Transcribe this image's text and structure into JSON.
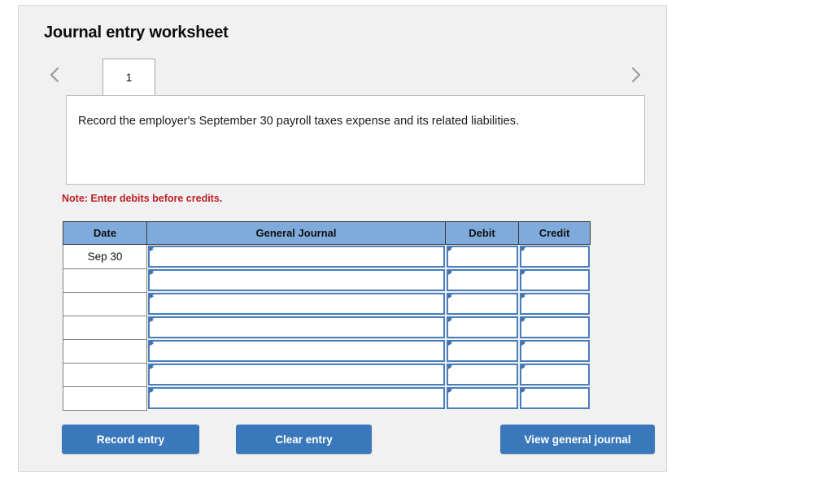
{
  "panel": {
    "title": "Journal entry worksheet"
  },
  "nav": {
    "prev_icon": "chevron-left-icon",
    "next_icon": "chevron-right-icon",
    "tabs": [
      {
        "label": "1",
        "active": true
      }
    ]
  },
  "instruction": {
    "text": "Record the employer's September 30 payroll taxes expense and its related liabilities."
  },
  "note": {
    "text": "Note: Enter debits before credits."
  },
  "table": {
    "headers": {
      "date": "Date",
      "general_journal": "General Journal",
      "debit": "Debit",
      "credit": "Credit"
    },
    "rows": [
      {
        "date": "Sep 30",
        "general_journal": "",
        "debit": "",
        "credit": ""
      },
      {
        "date": "",
        "general_journal": "",
        "debit": "",
        "credit": ""
      },
      {
        "date": "",
        "general_journal": "",
        "debit": "",
        "credit": ""
      },
      {
        "date": "",
        "general_journal": "",
        "debit": "",
        "credit": ""
      },
      {
        "date": "",
        "general_journal": "",
        "debit": "",
        "credit": ""
      },
      {
        "date": "",
        "general_journal": "",
        "debit": "",
        "credit": ""
      },
      {
        "date": "",
        "general_journal": "",
        "debit": "",
        "credit": ""
      }
    ]
  },
  "buttons": {
    "record": "Record entry",
    "clear": "Clear entry",
    "view": "View general journal"
  },
  "colors": {
    "header_blue": "#7fabdc",
    "button_blue": "#3a78bc",
    "field_border_blue": "#4a7ebb",
    "note_red": "#bf2026",
    "panel_bg": "#f1f1f1"
  }
}
